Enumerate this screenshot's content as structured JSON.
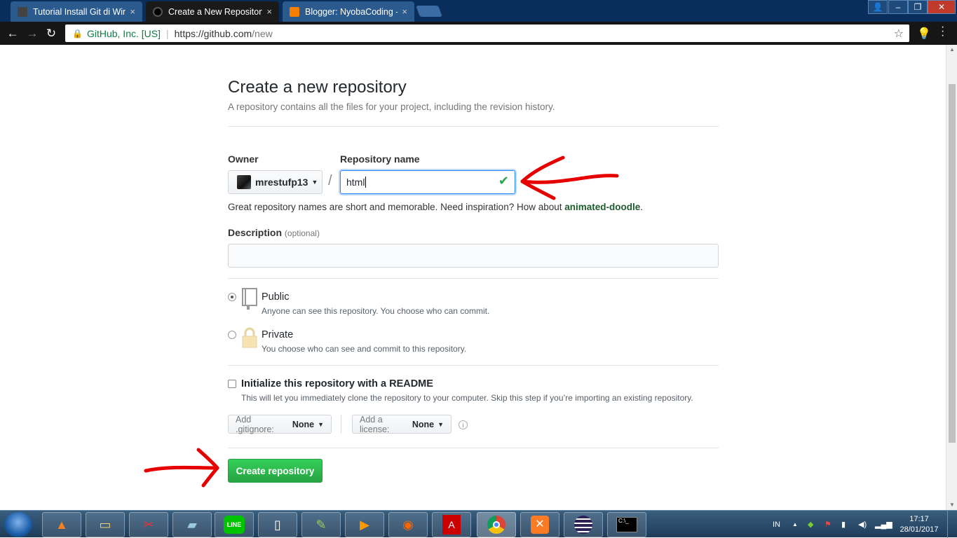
{
  "browser": {
    "tabs": [
      {
        "title": "Tutorial Install Git di Win",
        "close": "×"
      },
      {
        "title": "Create a New Repository",
        "close": "×"
      },
      {
        "title": "Blogger: NyobaCoding -",
        "close": "×"
      }
    ],
    "address": {
      "security_label": "GitHub, Inc. [US]",
      "url_host": "https://github.com",
      "url_path": "/new"
    }
  },
  "page": {
    "title": "Create a new repository",
    "subtitle": "A repository contains all the files for your project, including the revision history.",
    "owner_label": "Owner",
    "owner_value": "mrestufp13",
    "repo_name_label": "Repository name",
    "repo_name_value": "html",
    "hint_text": "Great repository names are short and memorable. Need inspiration? How about",
    "hint_suggestion": "animated-doodle",
    "hint_end": ".",
    "description_label": "Description",
    "description_optional": "(optional)",
    "description_value": "",
    "visibility": {
      "public_title": "Public",
      "public_note": "Anyone can see this repository. You choose who can commit.",
      "private_title": "Private",
      "private_note": "You choose who can see and commit to this repository.",
      "selected": "Public"
    },
    "readme": {
      "title": "Initialize this repository with a README",
      "note": "This will let you immediately clone the repository to your computer. Skip this step if you’re importing an existing repository.",
      "checked": false
    },
    "gitignore": {
      "label": "Add .gitignore:",
      "value": "None"
    },
    "license": {
      "label": "Add a license:",
      "value": "None"
    },
    "submit_label": "Create repository"
  },
  "taskbar": {
    "language": "IN",
    "time": "17:17",
    "date": "28/01/2017",
    "apps": [
      "vlc-icon",
      "file-explorer-icon",
      "snipping-tool-icon",
      "notepad-icon",
      "line-icon",
      "document-icon",
      "notepad-plus-icon",
      "media-player-icon",
      "uc-browser-icon",
      "acrobat-icon",
      "chrome-icon",
      "xampp-icon",
      "eclipse-icon",
      "cmd-icon"
    ]
  },
  "colors": {
    "accent_green": "#28a745",
    "annotation_red": "#e60000",
    "link_blue": "#2188ff"
  }
}
